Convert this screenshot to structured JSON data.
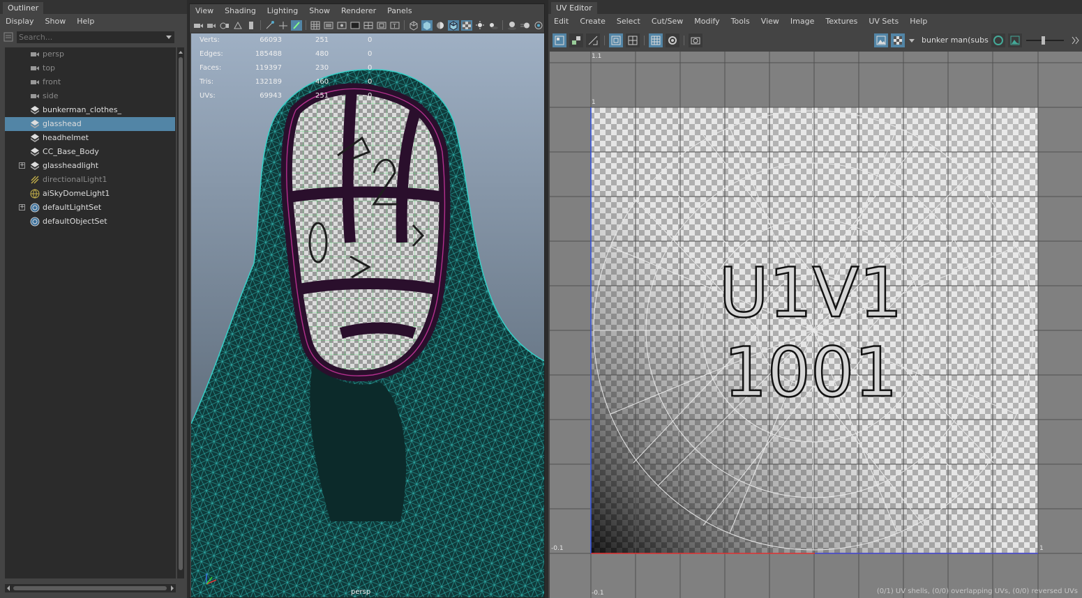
{
  "outliner": {
    "tab": "Outliner",
    "menu": [
      "Display",
      "Show",
      "Help"
    ],
    "search_placeholder": "Search...",
    "items": [
      {
        "label": "persp",
        "icon": "camera-icon",
        "dim": true,
        "expander": false,
        "selected": false
      },
      {
        "label": "top",
        "icon": "camera-icon",
        "dim": true,
        "expander": false,
        "selected": false
      },
      {
        "label": "front",
        "icon": "camera-icon",
        "dim": true,
        "expander": false,
        "selected": false
      },
      {
        "label": "side",
        "icon": "camera-icon",
        "dim": true,
        "expander": false,
        "selected": false
      },
      {
        "label": "bunkerman_clothes_",
        "icon": "mesh-icon",
        "dim": false,
        "expander": false,
        "selected": false
      },
      {
        "label": "glasshead",
        "icon": "mesh-icon",
        "dim": false,
        "expander": false,
        "selected": true
      },
      {
        "label": "headhelmet",
        "icon": "mesh-icon",
        "dim": false,
        "expander": false,
        "selected": false
      },
      {
        "label": "CC_Base_Body",
        "icon": "mesh-icon",
        "dim": false,
        "expander": false,
        "selected": false
      },
      {
        "label": "glassheadlight",
        "icon": "mesh-icon",
        "dim": false,
        "expander": true,
        "selected": false
      },
      {
        "label": "directionalLight1",
        "icon": "directional-light-icon",
        "dim": true,
        "expander": false,
        "selected": false
      },
      {
        "label": "aiSkyDomeLight1",
        "icon": "skydome-light-icon",
        "dim": false,
        "expander": false,
        "selected": false
      },
      {
        "label": "defaultLightSet",
        "icon": "set-icon",
        "dim": false,
        "expander": true,
        "selected": false
      },
      {
        "label": "defaultObjectSet",
        "icon": "set-icon",
        "dim": false,
        "expander": false,
        "selected": false
      }
    ]
  },
  "viewport": {
    "menu": [
      "View",
      "Shading",
      "Lighting",
      "Show",
      "Renderer",
      "Panels"
    ],
    "hud": [
      {
        "label": "Verts:",
        "total": "66093",
        "selected": "251",
        "extra": "0"
      },
      {
        "label": "Edges:",
        "total": "185488",
        "selected": "480",
        "extra": "0"
      },
      {
        "label": "Faces:",
        "total": "119397",
        "selected": "230",
        "extra": "0"
      },
      {
        "label": "Tris:",
        "total": "132189",
        "selected": "460",
        "extra": "0"
      },
      {
        "label": "UVs:",
        "total": "69943",
        "selected": "251",
        "extra": "0"
      }
    ],
    "camera": "persp"
  },
  "uv_editor": {
    "tab": "UV Editor",
    "menu": [
      "Edit",
      "Create",
      "Select",
      "Cut/Sew",
      "Modify",
      "Tools",
      "View",
      "Image",
      "Textures",
      "UV Sets",
      "Help"
    ],
    "texture_name": "bunker man(substanc",
    "tile_label_line1": "U1V1",
    "tile_label_line2": "1001",
    "axis_labels": {
      "top": "1.1",
      "one": "1",
      "left": "-0.1",
      "right": "1",
      "bottom": "-0.1"
    },
    "status": "(0/1) UV shells, (0/0) overlapping UVs, (0/0) reversed UVs",
    "colors": {
      "u_axis": "#e03030",
      "v_axis": "#3050e0",
      "selection": "#5285a6"
    }
  }
}
